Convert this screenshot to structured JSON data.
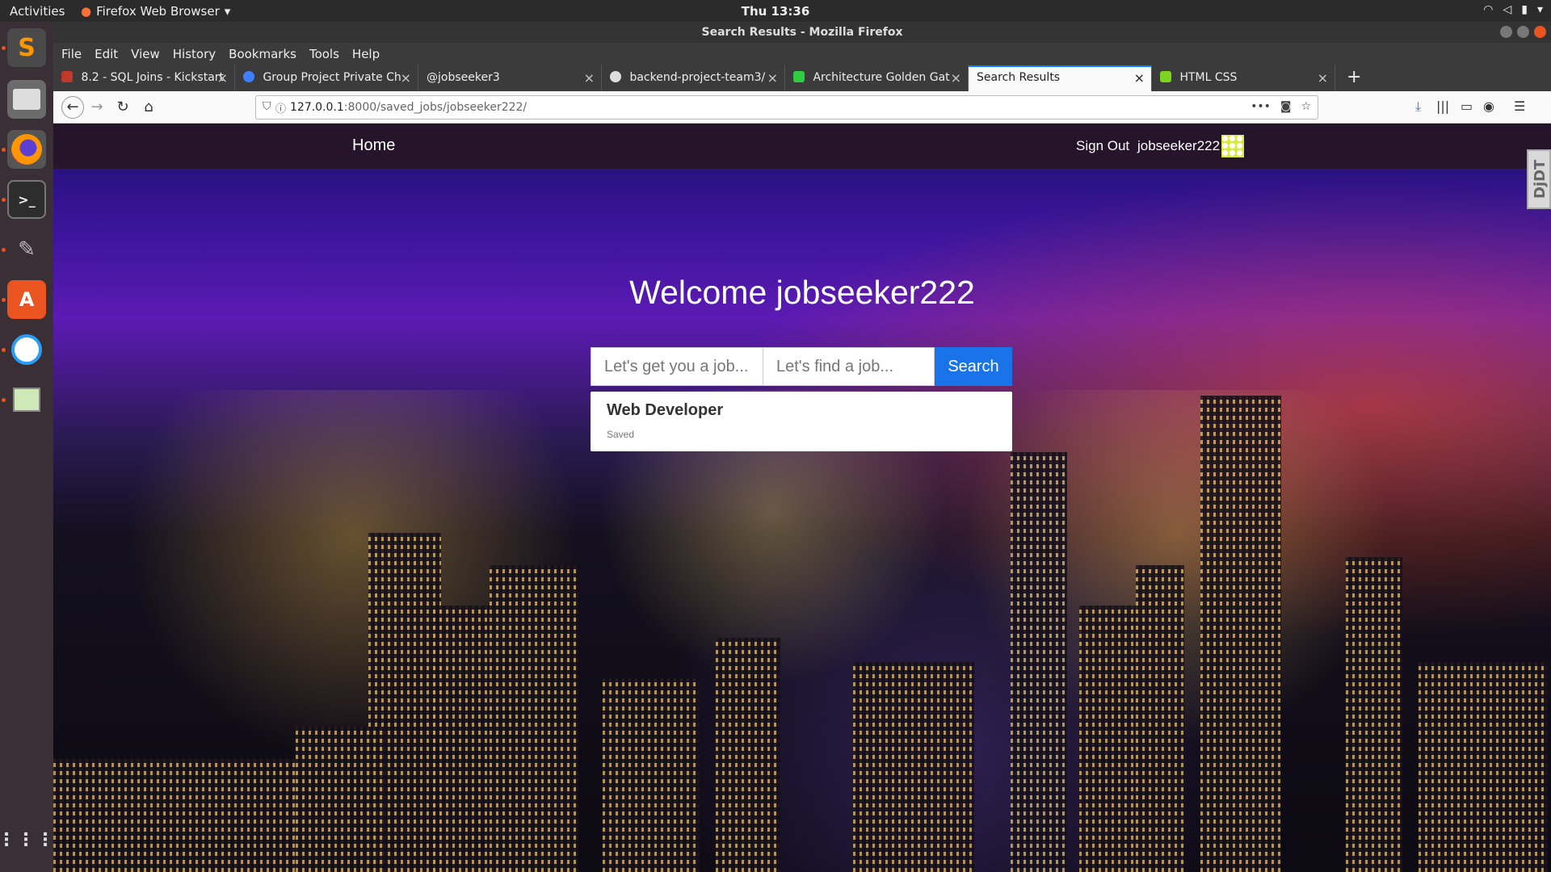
{
  "topbar": {
    "activities": "Activities",
    "app_name": "Firefox Web Browser",
    "clock": "Thu 13:36"
  },
  "window": {
    "title": "Search Results - Mozilla Firefox"
  },
  "menu": [
    "File",
    "Edit",
    "View",
    "History",
    "Bookmarks",
    "Tools",
    "Help"
  ],
  "tabs": [
    {
      "label": "8.2 - SQL Joins - Kickstart",
      "icon_color": "#c0392b",
      "active": false
    },
    {
      "label": "Group Project Private Ch",
      "icon_color": "#3d7fff",
      "active": false
    },
    {
      "label": "@jobseeker3",
      "icon_color": "#3b3b3b",
      "active": false
    },
    {
      "label": "backend-project-team3/",
      "icon_color": "#dddddd",
      "active": false
    },
    {
      "label": "Architecture Golden Gat",
      "icon_color": "#2ecc40",
      "active": false
    },
    {
      "label": "Search Results",
      "icon_color": "#f9f9fa",
      "active": true
    },
    {
      "label": "HTML CSS",
      "icon_color": "#7ed321",
      "active": false
    }
  ],
  "url": {
    "host": "127.0.0.1",
    "path": ":8000/saved_jobs/jobseeker222/"
  },
  "site": {
    "nav_home": "Home",
    "sign_out": "Sign Out",
    "username": "jobseeker222",
    "side_tab": "DjDT",
    "welcome": "Welcome jobseeker222",
    "search": {
      "placeholder_what": "Let's get you a job...",
      "placeholder_where": "Let's find a job...",
      "button": "Search"
    },
    "results": [
      {
        "title": "Web Developer",
        "status": "Saved"
      }
    ]
  },
  "colors": {
    "accent": "#1a73e8",
    "ubuntu_orange": "#e95420",
    "tab_highlight": "#0a84ff"
  }
}
